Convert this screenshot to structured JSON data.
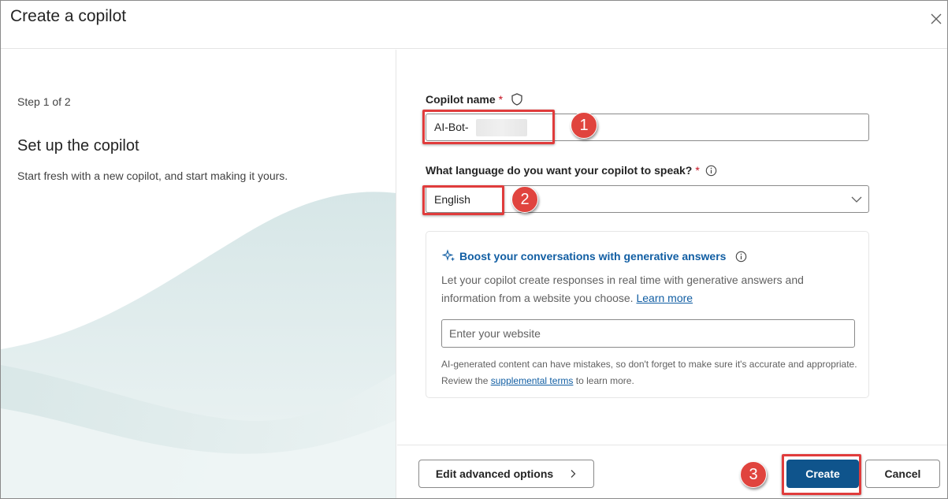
{
  "dialog": {
    "title": "Create a copilot",
    "close_icon": "close-icon"
  },
  "left_pane": {
    "step": "Step 1 of 2",
    "title": "Set up the copilot",
    "description": "Start fresh with a new copilot, and start making it yours."
  },
  "form": {
    "name_label": "Copilot name",
    "required_marker": "*",
    "name_value": "AI-Bot-",
    "language_label": "What language do you want your copilot to speak?",
    "language_value": "English"
  },
  "generative": {
    "title": "Boost your conversations with generative answers",
    "description": "Let your copilot create responses in real time with generative answers and information from a website you choose.",
    "learn_more": "Learn more",
    "website_placeholder": "Enter your website",
    "disclaimer_start": "AI-generated content can have mistakes, so don't forget to make sure it's accurate and appropriate. Review the",
    "disclaimer_link": "supplemental terms",
    "disclaimer_end": "to learn more."
  },
  "footer": {
    "edit_advanced": "Edit advanced options",
    "create": "Create",
    "cancel": "Cancel"
  },
  "annotations": {
    "one": "1",
    "two": "2",
    "three": "3"
  },
  "colors": {
    "accent": "#0f548c",
    "link": "#115ea3",
    "annotation_red": "#e03c3c",
    "required": "#c50f1f"
  }
}
